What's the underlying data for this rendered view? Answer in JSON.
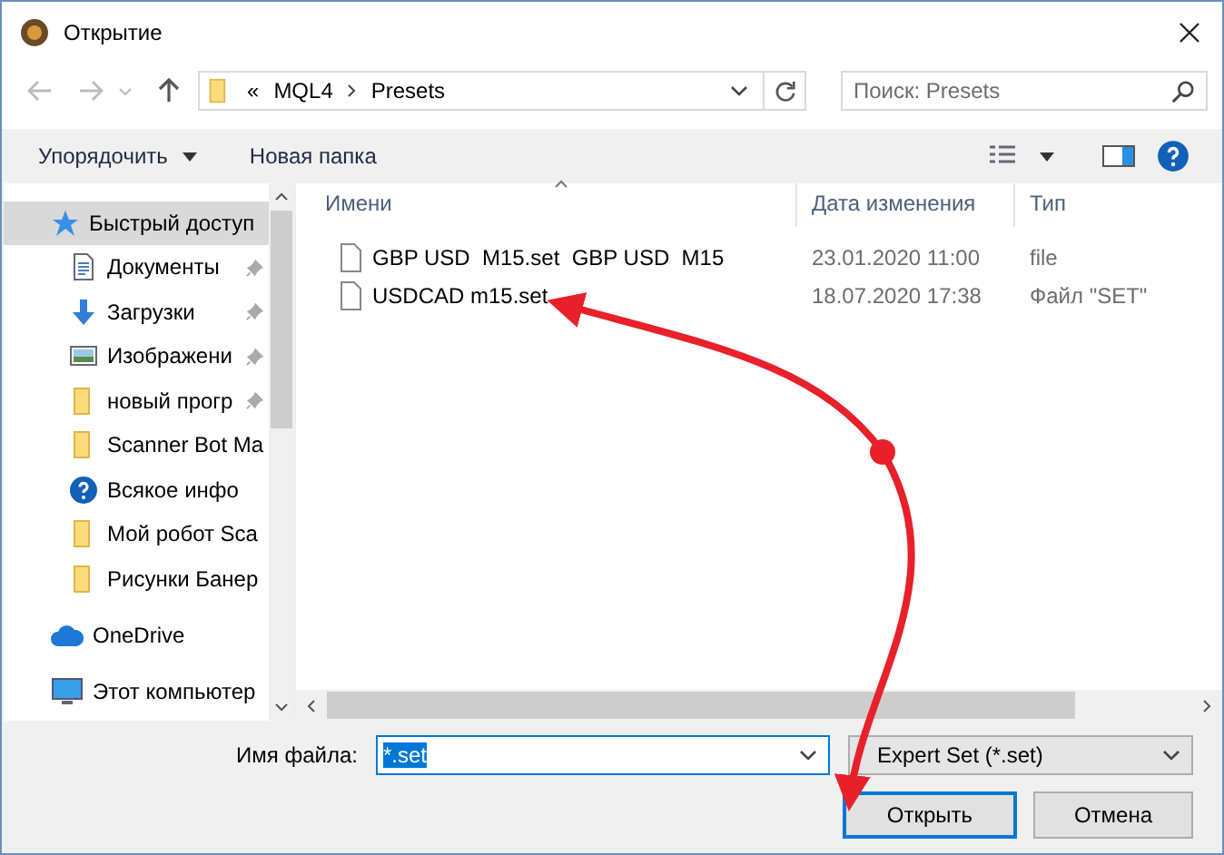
{
  "window": {
    "title": "Открытие"
  },
  "address": {
    "path": [
      {
        "label": "«"
      },
      {
        "label": "MQL4"
      },
      {
        "label": "Presets"
      }
    ]
  },
  "search": {
    "placeholder": "Поиск: Presets"
  },
  "toolbar": {
    "organize": "Упорядочить",
    "new_folder": "Новая папка"
  },
  "sidebar": {
    "items": [
      {
        "label": "Быстрый доступ",
        "kind": "star",
        "selected": true,
        "pinned": false,
        "children": [
          {
            "label": "Документы",
            "kind": "documents",
            "selected": false,
            "pinned": true
          },
          {
            "label": "Загрузки",
            "kind": "downloads",
            "selected": false,
            "pinned": true
          },
          {
            "label": "Изображени",
            "kind": "pictures",
            "selected": false,
            "pinned": true
          },
          {
            "label": "новый прогр",
            "kind": "folder",
            "selected": false,
            "pinned": true
          },
          {
            "label": "Scanner Bot Ma",
            "kind": "folder",
            "selected": false,
            "pinned": false
          },
          {
            "label": "Всякое инфо",
            "kind": "help",
            "selected": false,
            "pinned": false
          },
          {
            "label": "Мой робот Sca",
            "kind": "folder",
            "selected": false,
            "pinned": false
          },
          {
            "label": "Рисунки Банер",
            "kind": "folder",
            "selected": false,
            "pinned": false
          }
        ]
      },
      {
        "label": "OneDrive",
        "kind": "cloud",
        "selected": false,
        "pinned": false
      },
      {
        "label": "Этот компьютер",
        "kind": "computer",
        "selected": false,
        "pinned": false
      }
    ]
  },
  "table": {
    "columns": [
      "Имени",
      "Дата изменения",
      "Тип"
    ],
    "rows": [
      {
        "name": "GBP USD  M15.set  GBP USD  M15",
        "date": "23.01.2020 11:00",
        "type": "file"
      },
      {
        "name": "USDCAD m15.set",
        "date": "18.07.2020 17:38",
        "type": "Файл \"SET\""
      }
    ]
  },
  "filename": {
    "label": "Имя файла:",
    "value": "*.set"
  },
  "filter": {
    "value": "Expert Set (*.set)"
  },
  "buttons": [
    {
      "label": "Открыть",
      "kind": "default"
    },
    {
      "label": "Отмена",
      "kind": "normal"
    }
  ]
}
